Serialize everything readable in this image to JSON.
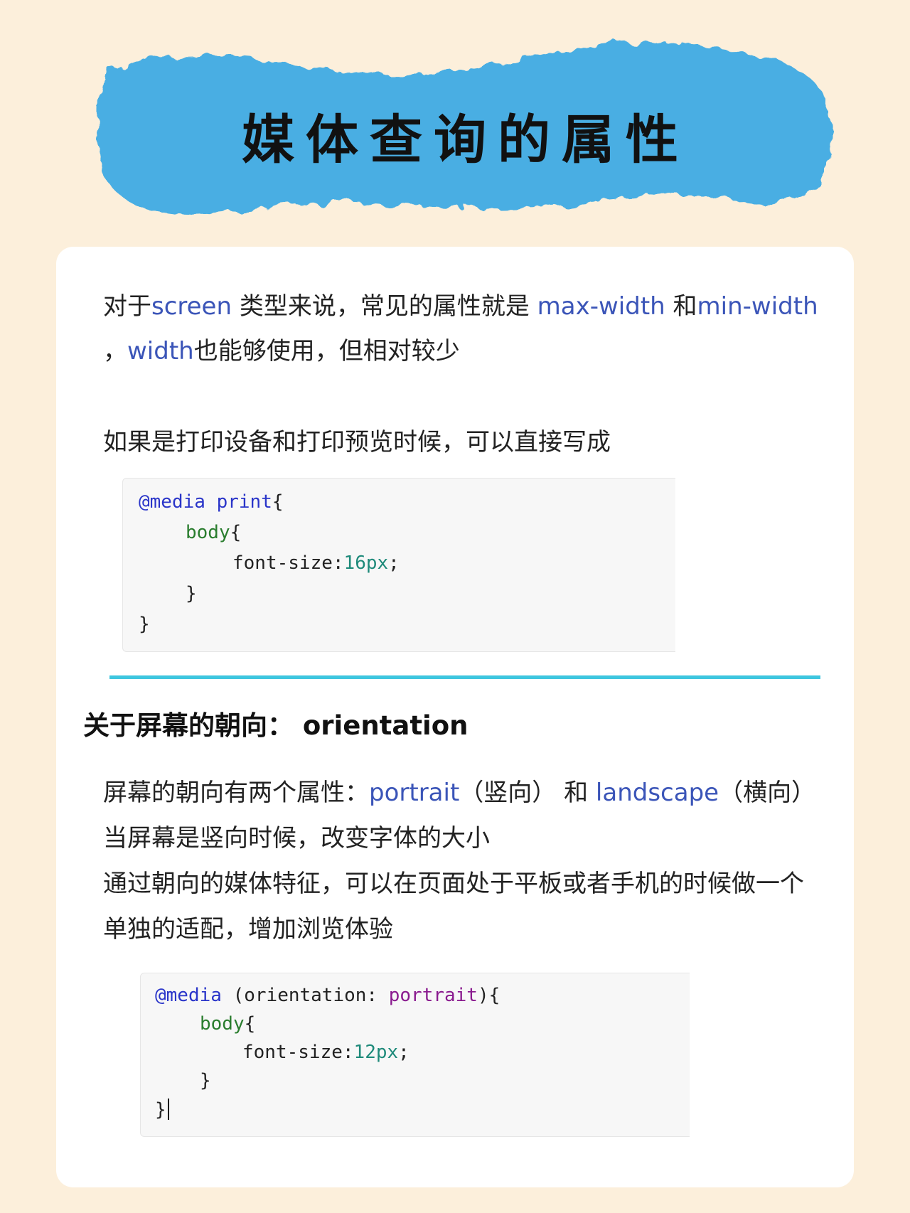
{
  "title": "媒体查询的属性",
  "section1": {
    "line1_a": "对于",
    "line1_kw1": "screen",
    "line1_b": " 类型来说，常见的属性就是 ",
    "line1_kw2": "max-width",
    "line1_c": " 和",
    "line1_kw3": "min-width",
    "line2_a": "，",
    "line2_kw": "width",
    "line2_b": "也能够使用，但相对较少",
    "line3": "如果是打印设备和打印预览时候，可以直接写成"
  },
  "code1": {
    "l1_at": "@media",
    "l1_sp": " ",
    "l1_print": "print",
    "l1_brace": "{",
    "l2_sel": "body",
    "l2_brace": "{",
    "l3_prop": "font-size:",
    "l3_val": "16px",
    "l3_semi": ";",
    "l4": "}",
    "l5": "}"
  },
  "heading": "关于屏幕的朝向： orientation",
  "section2": {
    "line1_a": "屏幕的朝向有两个属性：",
    "line1_kw1": "portrait",
    "line1_b": "（竖向） 和 ",
    "line1_kw2": "landscape",
    "line1_c": "（横向）",
    "line2": "当屏幕是竖向时候，改变字体的大小",
    "line3": "通过朝向的媒体特征，可以在页面处于平板或者手机的时候做一个",
    "line4": "单独的适配，增加浏览体验"
  },
  "code2": {
    "l1_at": "@media",
    "l1_paren": " (orientation: ",
    "l1_val": "portrait",
    "l1_close": "){",
    "l2_sel": "body",
    "l2_brace": "{",
    "l3_prop": "font-size:",
    "l3_val": "12px",
    "l3_semi": ";",
    "l4": "}",
    "l5": "}"
  },
  "colors": {
    "background": "#fcefdb",
    "brush": "#4aaee3",
    "keyword": "#3b55b8",
    "divider": "#3ec6df"
  }
}
